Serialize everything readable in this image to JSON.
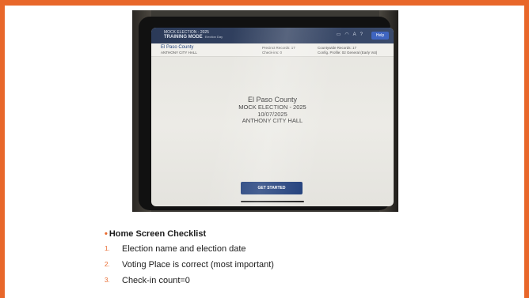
{
  "tablet": {
    "topbar": {
      "line1": "MOCK ELECTION - 2025",
      "mode": "TRAINING MODE",
      "mode_sub": "Election Day",
      "icons": [
        "battery-icon",
        "wifi-icon",
        "text-size-icon",
        "help-icon"
      ],
      "help": "Help"
    },
    "info": {
      "county": "El Paso County",
      "place": "ANTHONY CITY HALL",
      "precinct_records_label": "Precinct Records:",
      "precinct_records": "17",
      "checkins_label": "Check-ins:",
      "checkins": "0",
      "countywide_records_label": "Countywide Records:",
      "countywide_records": "17",
      "config_profile_label": "Config. Profile:",
      "config_profile": "02 General (Early Vot)"
    },
    "center": {
      "county": "El Paso County",
      "election": "MOCK ELECTION - 2025",
      "date": "10/07/2025",
      "place": "ANTHONY CITY HALL"
    },
    "button": "GET STARTED"
  },
  "checklist": {
    "bullet": "•",
    "heading": "Home Screen Checklist",
    "items": [
      {
        "num": "1.",
        "text": "Election name and election date"
      },
      {
        "num": "2.",
        "text": "Voting Place is correct (most important)"
      },
      {
        "num": "3.",
        "text": "Check-in count=0"
      }
    ]
  },
  "colors": {
    "frame": "#e8672a",
    "accent": "#e8672a",
    "button": "#1f3d7a"
  }
}
